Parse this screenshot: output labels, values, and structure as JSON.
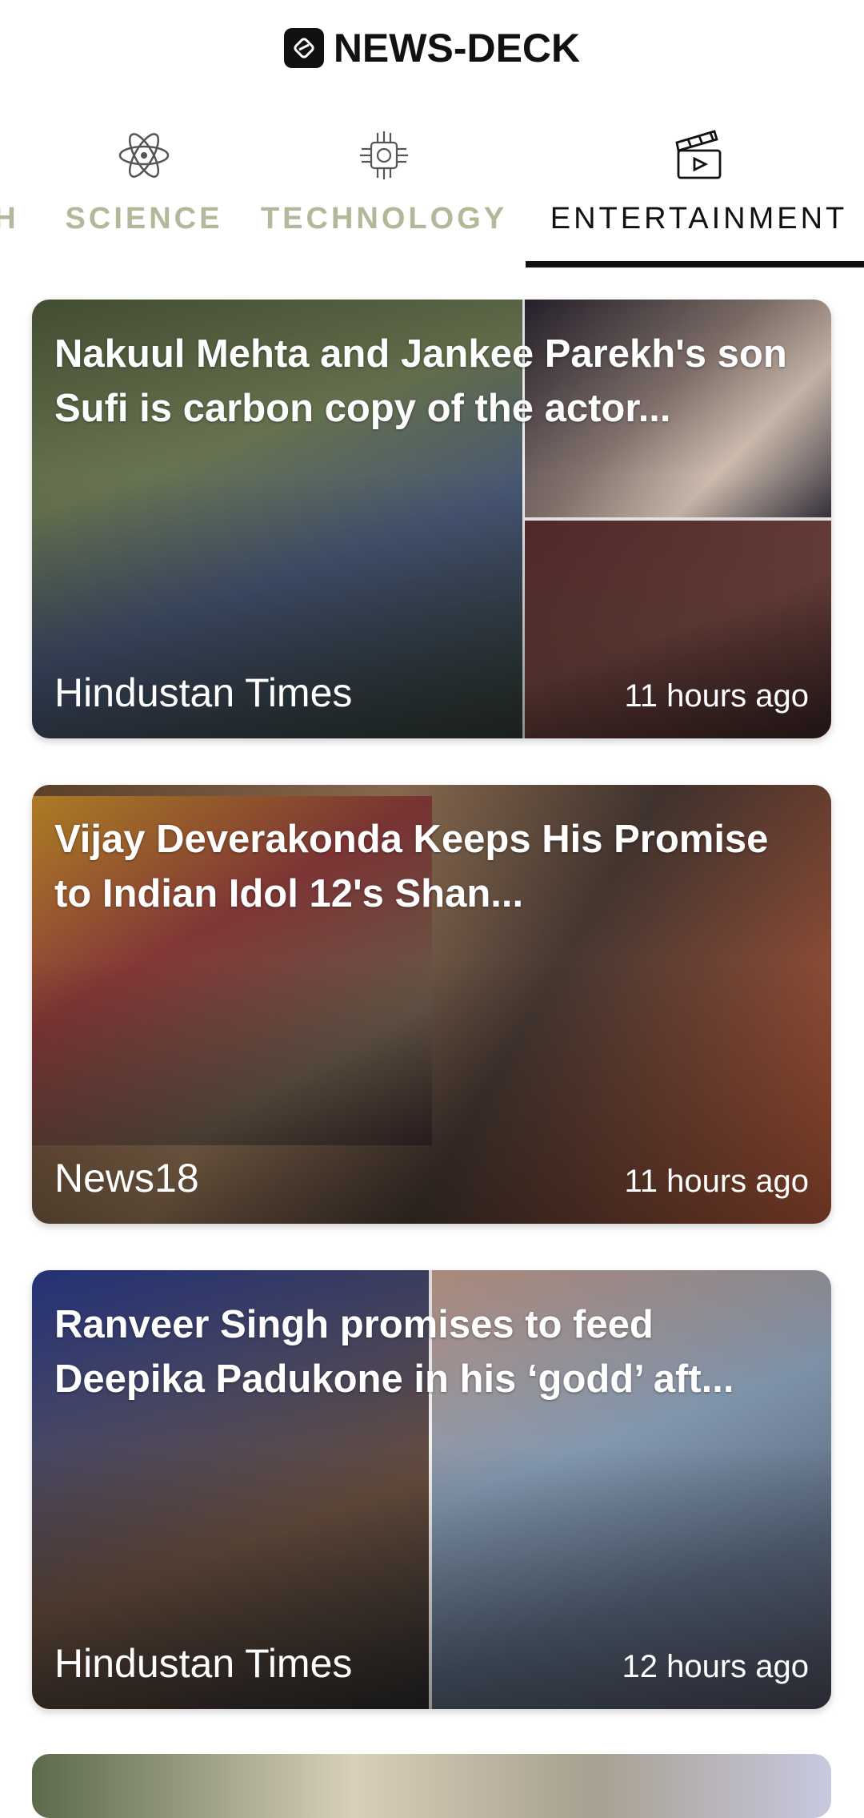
{
  "header": {
    "title": "NEWS-DECK"
  },
  "tabs": [
    {
      "label": "H",
      "icon": "partial"
    },
    {
      "label": "SCIENCE",
      "icon": "atom-icon"
    },
    {
      "label": "TECHNOLOGY",
      "icon": "chip-icon"
    },
    {
      "label": "ENTERTAINMENT",
      "icon": "clapperboard-icon",
      "active": true
    }
  ],
  "articles": [
    {
      "headline": "Nakuul Mehta and Jankee Parekh's son Sufi is carbon copy of the actor...",
      "source": "Hindustan Times",
      "time": "11 hours ago"
    },
    {
      "headline": "Vijay Deverakonda Keeps His Promise to Indian Idol 12's Shan...",
      "source": "News18",
      "time": "11 hours ago"
    },
    {
      "headline": "Ranveer Singh promises to feed Deepika Padukone in his ‘godd’ aft...",
      "source": "Hindustan Times",
      "time": "12 hours ago"
    }
  ],
  "colors": {
    "tab_inactive": "#b4b79a",
    "tab_active": "#111111"
  }
}
